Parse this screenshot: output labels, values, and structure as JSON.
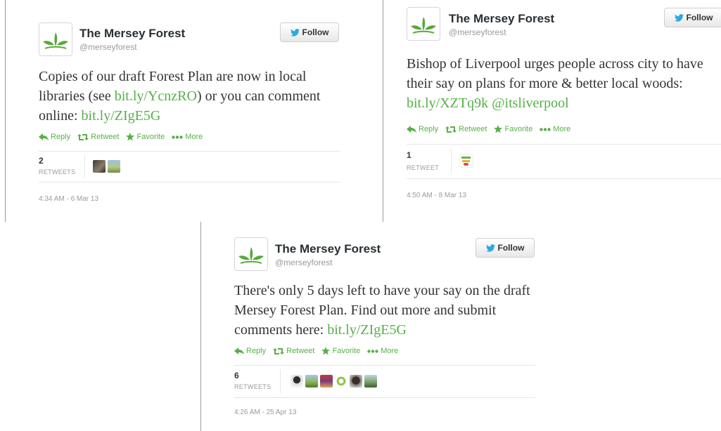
{
  "tweets": [
    {
      "name": "The Mersey Forest",
      "handle": "@merseyforest",
      "follow_label": "Follow",
      "text_parts": [
        "Copies of our draft Forest Plan are now in local libraries (see ",
        "bit.ly/YcnzRO",
        ") or you can comment online: ",
        "bit.ly/ZIgE5G",
        ""
      ],
      "actions": {
        "reply": "Reply",
        "retweet": "Retweet",
        "favorite": "Favorite",
        "more": "More"
      },
      "retweet_count": "2",
      "retweet_label": "RETWEETS",
      "timestamp": "4:34 AM - 6 Mar 13"
    },
    {
      "name": "The Mersey Forest",
      "handle": "@merseyforest",
      "follow_label": "Follow",
      "text_parts": [
        "Bishop of Liverpool urges people across city to have their say on plans for more & better local woods: ",
        "bit.ly/XZTq9k",
        " ",
        "@itsliverpool",
        ""
      ],
      "actions": {
        "reply": "Reply",
        "retweet": "Retweet",
        "favorite": "Favorite",
        "more": "More"
      },
      "retweet_count": "1",
      "retweet_label": "RETWEET",
      "timestamp": "4:50 AM - 8 Mar 13"
    },
    {
      "name": "The Mersey Forest",
      "handle": "@merseyforest",
      "follow_label": "Follow",
      "text_parts": [
        "There's only 5 days left to have your say on the draft Mersey Forest Plan. Find out more and submit comments here: ",
        "bit.ly/ZIgE5G",
        "",
        "",
        ""
      ],
      "actions": {
        "reply": "Reply",
        "retweet": "Retweet",
        "favorite": "Favorite",
        "more": "More"
      },
      "retweet_count": "6",
      "retweet_label": "RETWEETS",
      "timestamp": "4:26 AM - 25 Apr 13"
    }
  ],
  "colors": {
    "link": "#55b048",
    "action": "#58b047",
    "twitter_blue": "#2aa9e0"
  }
}
